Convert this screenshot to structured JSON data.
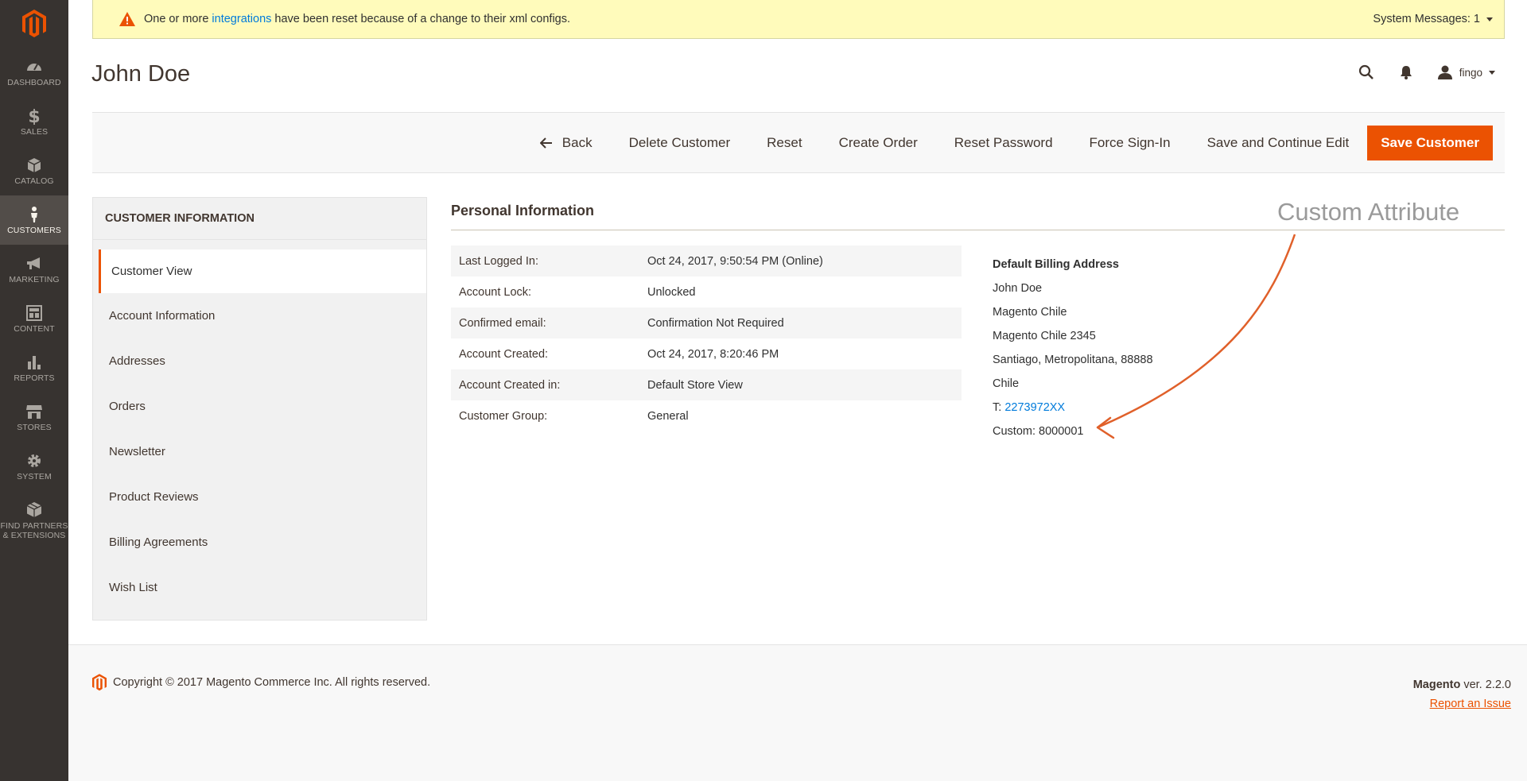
{
  "sidebar": {
    "items": [
      {
        "label": "DASHBOARD",
        "icon": "dashboard-icon"
      },
      {
        "label": "SALES",
        "icon": "dollar-icon"
      },
      {
        "label": "CATALOG",
        "icon": "box-icon"
      },
      {
        "label": "CUSTOMERS",
        "icon": "person-icon"
      },
      {
        "label": "MARKETING",
        "icon": "megaphone-icon"
      },
      {
        "label": "CONTENT",
        "icon": "layout-icon"
      },
      {
        "label": "REPORTS",
        "icon": "bar-chart-icon"
      },
      {
        "label": "STORES",
        "icon": "storefront-icon"
      },
      {
        "label": "SYSTEM",
        "icon": "gear-icon"
      },
      {
        "label_line1": "FIND PARTNERS",
        "label_line2": "& EXTENSIONS",
        "icon": "extensions-icon"
      }
    ]
  },
  "system_message": {
    "prefix": "One or more ",
    "link": "integrations",
    "suffix": " have been reset because of a change to their xml configs.",
    "count_label": "System Messages: 1"
  },
  "header": {
    "title": "John Doe",
    "user": "fingo"
  },
  "toolbar": {
    "back": "Back",
    "delete": "Delete Customer",
    "reset": "Reset",
    "create_order": "Create Order",
    "reset_password": "Reset Password",
    "force_signin": "Force Sign-In",
    "save_continue": "Save and Continue Edit",
    "save": "Save Customer"
  },
  "tabs": {
    "title": "CUSTOMER INFORMATION",
    "items": [
      "Customer View",
      "Account Information",
      "Addresses",
      "Orders",
      "Newsletter",
      "Product Reviews",
      "Billing Agreements",
      "Wish List"
    ]
  },
  "personal": {
    "title": "Personal Information",
    "rows": [
      {
        "k": "Last Logged In:",
        "v": "Oct 24, 2017, 9:50:54 PM (Online)"
      },
      {
        "k": "Account Lock:",
        "v": "Unlocked"
      },
      {
        "k": "Confirmed email:",
        "v": "Confirmation Not Required"
      },
      {
        "k": "Account Created:",
        "v": "Oct 24, 2017, 8:20:46 PM"
      },
      {
        "k": "Account Created in:",
        "v": "Default Store View"
      },
      {
        "k": "Customer Group:",
        "v": "General"
      }
    ]
  },
  "billing": {
    "heading": "Default Billing Address",
    "name": "John Doe",
    "company": "Magento Chile",
    "street": "Magento Chile 2345",
    "city": "Santiago, Metropolitana, 88888",
    "country": "Chile",
    "phone_prefix": "T: ",
    "phone": "2273972XX",
    "custom": "Custom: 8000001"
  },
  "annotation": {
    "text": "Custom Attribute",
    "color": "#e0602a"
  },
  "footer": {
    "copyright": "Copyright © 2017 Magento Commerce Inc. All rights reserved.",
    "brand": "Magento",
    "version": " ver. 2.2.0",
    "report": "Report an Issue"
  },
  "colors": {
    "accent": "#eb5202",
    "sidebar": "#373330",
    "link": "#007bdb"
  }
}
